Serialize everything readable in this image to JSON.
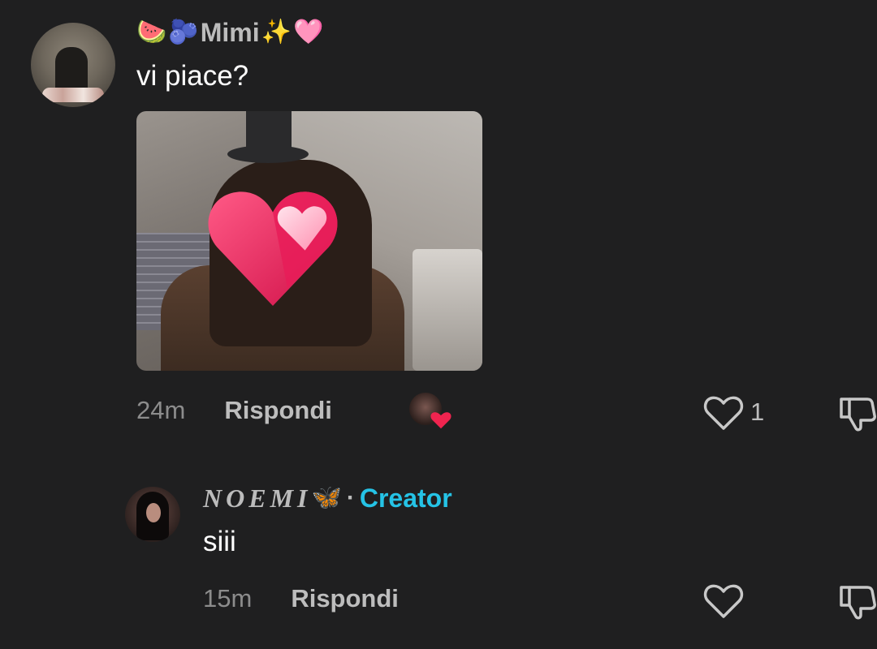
{
  "comments": [
    {
      "username": "Mimi",
      "username_emoji_prefix": [
        "🍉",
        "🫐"
      ],
      "username_emoji_suffix": [
        "✨",
        "🩷"
      ],
      "text": "vi piace?",
      "time": "24m",
      "reply_label": "Rispondi",
      "like_count": "1"
    },
    {
      "username": "NOEMI",
      "username_emoji_suffix": [
        "🦋"
      ],
      "separator": "·",
      "badge": "Creator",
      "text": "siii",
      "time": "15m",
      "reply_label": "Rispondi"
    }
  ],
  "colors": {
    "background": "#1f1f20",
    "creator_badge": "#25c3e6",
    "muted_text": "#8c8c8c"
  },
  "icons": [
    "heart-outline-icon",
    "dislike-icon",
    "heart-sticker-icon"
  ]
}
